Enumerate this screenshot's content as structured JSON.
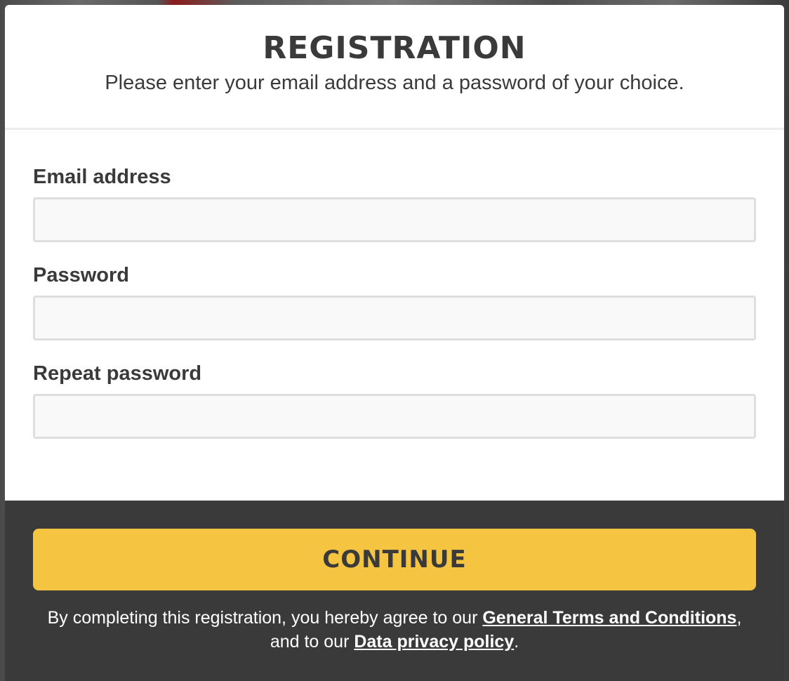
{
  "header": {
    "title": "REGISTRATION",
    "subtitle": "Please enter your email address and a password of your choice."
  },
  "form": {
    "email": {
      "label": "Email address",
      "value": "",
      "placeholder": ""
    },
    "password": {
      "label": "Password",
      "value": "",
      "placeholder": ""
    },
    "repeat_password": {
      "label": "Repeat password",
      "value": "",
      "placeholder": ""
    }
  },
  "footer": {
    "continue_label": "CONTINUE",
    "legal": {
      "prefix": "By completing this registration, you hereby agree to our ",
      "terms_link": "General Terms and Conditions",
      "middle": ",",
      "middle2": "and to our ",
      "privacy_link": "Data privacy policy",
      "suffix": "."
    }
  },
  "colors": {
    "accent": "#f5c542",
    "footer_bg": "#3a3a3a",
    "text": "#3a3a3a"
  }
}
